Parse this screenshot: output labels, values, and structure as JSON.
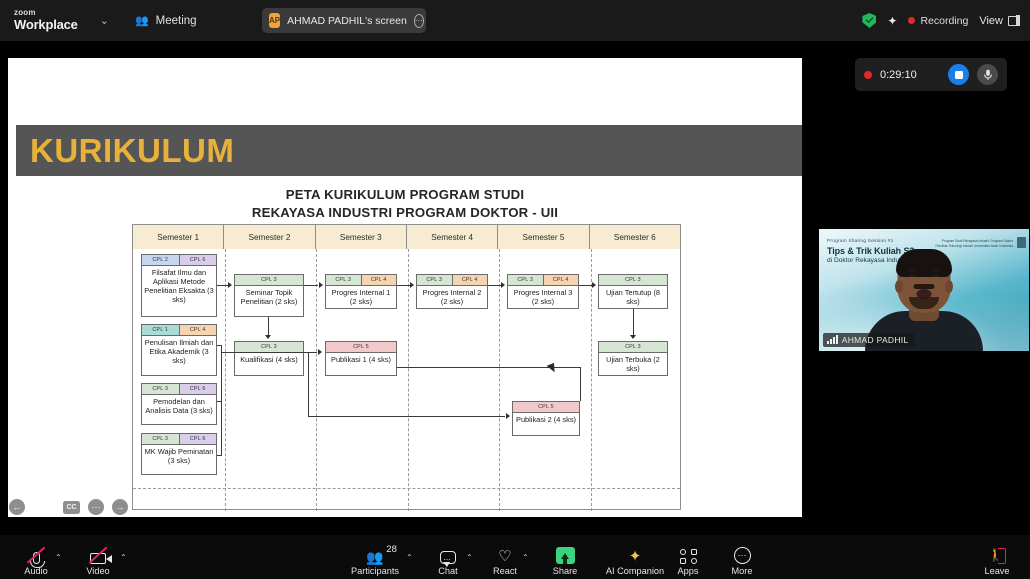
{
  "app": {
    "brand_top": "zoom",
    "brand_bottom": "Workplace",
    "chevron": "⌄",
    "meeting_tab": "Meeting",
    "people_icon": "👥",
    "accent_blue": "#1a7fe8",
    "accent_green": "#3dd27f",
    "accent_red": "#e02645",
    "accent_gold": "#e8b13c"
  },
  "screen_pill": {
    "avatar_initials": "AP",
    "label": "AHMAD PADHIL's screen",
    "menu_icon": "⋯"
  },
  "top_right": {
    "shield_name": "encryption-shield",
    "sparkle": "✦",
    "recording_label": "Recording",
    "view_label": "View"
  },
  "recording_widget": {
    "timer": "0:29:10",
    "stop_name": "stop-recording",
    "mic_icon": "🎤"
  },
  "slide": {
    "banner_title": "KURIKULUM",
    "title_line1": "PETA KURIKULUM PROGRAM STUDI",
    "title_line2": "REKAYASA INDUSTRI PROGRAM DOKTOR  - UII",
    "semesters": [
      "Semester 1",
      "Semester 2",
      "Semester 3",
      "Semester 4",
      "Semester 5",
      "Semester 6"
    ],
    "courses": [
      {
        "id": "c1",
        "tags": [
          "CPL 2",
          "CPL 6"
        ],
        "tag_colors": [
          "#c7d6ef",
          "#d9cdea"
        ],
        "name": "Filsafat Ilmu dan Aplikasi Metode Penelitian Eksakta (3 sks)"
      },
      {
        "id": "c2",
        "tags": [
          "CPL 1",
          "CPL 4"
        ],
        "tag_colors": [
          "#a9dcd8",
          "#f6d4b0"
        ],
        "name": "Penulisan Ilmiah dan Etika Akademik (3 sks)"
      },
      {
        "id": "c3",
        "tags": [
          "CPL 3",
          "CPL 6"
        ],
        "tag_colors": [
          "#d5e6d2",
          "#d9cdea"
        ],
        "name": "Pemodelan dan Analisis Data (3 sks)"
      },
      {
        "id": "c4",
        "tags": [
          "CPL 3",
          "CPL 6"
        ],
        "tag_colors": [
          "#d5e6d2",
          "#d9cdea"
        ],
        "name": "MK Wajib Peminatan (3 sks)"
      },
      {
        "id": "c5",
        "tags": [
          "CPL 3"
        ],
        "tag_colors": [
          "#d5e6d2"
        ],
        "name": "Seminar Topik Penelitian (2 sks)"
      },
      {
        "id": "c6",
        "tags": [
          "CPL 3"
        ],
        "tag_colors": [
          "#d5e6d2"
        ],
        "name": "Kualifikasi (4 sks)"
      },
      {
        "id": "c7",
        "tags": [
          "CPL 3",
          "CPL 4"
        ],
        "tag_colors": [
          "#d5e6d2",
          "#f6d4b0"
        ],
        "name": "Progres Internal 1 (2 sks)"
      },
      {
        "id": "c8",
        "tags": [
          "CPL 5"
        ],
        "tag_colors": [
          "#f2c9cb"
        ],
        "name": "Publikasi 1 (4 sks)"
      },
      {
        "id": "c9",
        "tags": [
          "CPL 3",
          "CPL 4"
        ],
        "tag_colors": [
          "#d5e6d2",
          "#f6d4b0"
        ],
        "name": "Progres Internal 2 (2 sks)"
      },
      {
        "id": "c10",
        "tags": [
          "CPL 3",
          "CPL 4"
        ],
        "tag_colors": [
          "#d5e6d2",
          "#f6d4b0"
        ],
        "name": "Progres Internal 3 (2 sks)"
      },
      {
        "id": "c11",
        "tags": [
          "CPL 5"
        ],
        "tag_colors": [
          "#f2c9cb"
        ],
        "name": "Publikasi 2 (4 sks)"
      },
      {
        "id": "c12",
        "tags": [
          "CPL 3"
        ],
        "tag_colors": [
          "#d5e6d2"
        ],
        "name": "Ujian Tertutup (8 sks)"
      },
      {
        "id": "c13",
        "tags": [
          "CPL 3"
        ],
        "tag_colors": [
          "#d5e6d2"
        ],
        "name": "Ujian Terbuka (2 sks)"
      }
    ]
  },
  "slide_nav": {
    "prev": "←",
    "next": "→",
    "cc": "CC",
    "more": "⋯",
    "pen": "✎"
  },
  "video_tile": {
    "bg_line1": "Program Sharing Session #1",
    "bg_line2": "Tips & Trik Kuliah S3",
    "bg_line3": "di Doktor Rekayasa Industri FTI-UII",
    "corner_line1": "Program Studi Rekayasa Industri, Program Doktor",
    "corner_line2": "Fakultas Teknologi Industri Universitas Islam Indonesia",
    "participant_name": "AHMAD PADHIL"
  },
  "toolbar": {
    "audio": "Audio",
    "video": "Video",
    "participants": "Participants",
    "participant_count": "28",
    "chat": "Chat",
    "react": "React",
    "share": "Share",
    "ai_companion": "AI Companion",
    "apps": "Apps",
    "more": "More",
    "leave": "Leave",
    "caret": "⌃"
  }
}
